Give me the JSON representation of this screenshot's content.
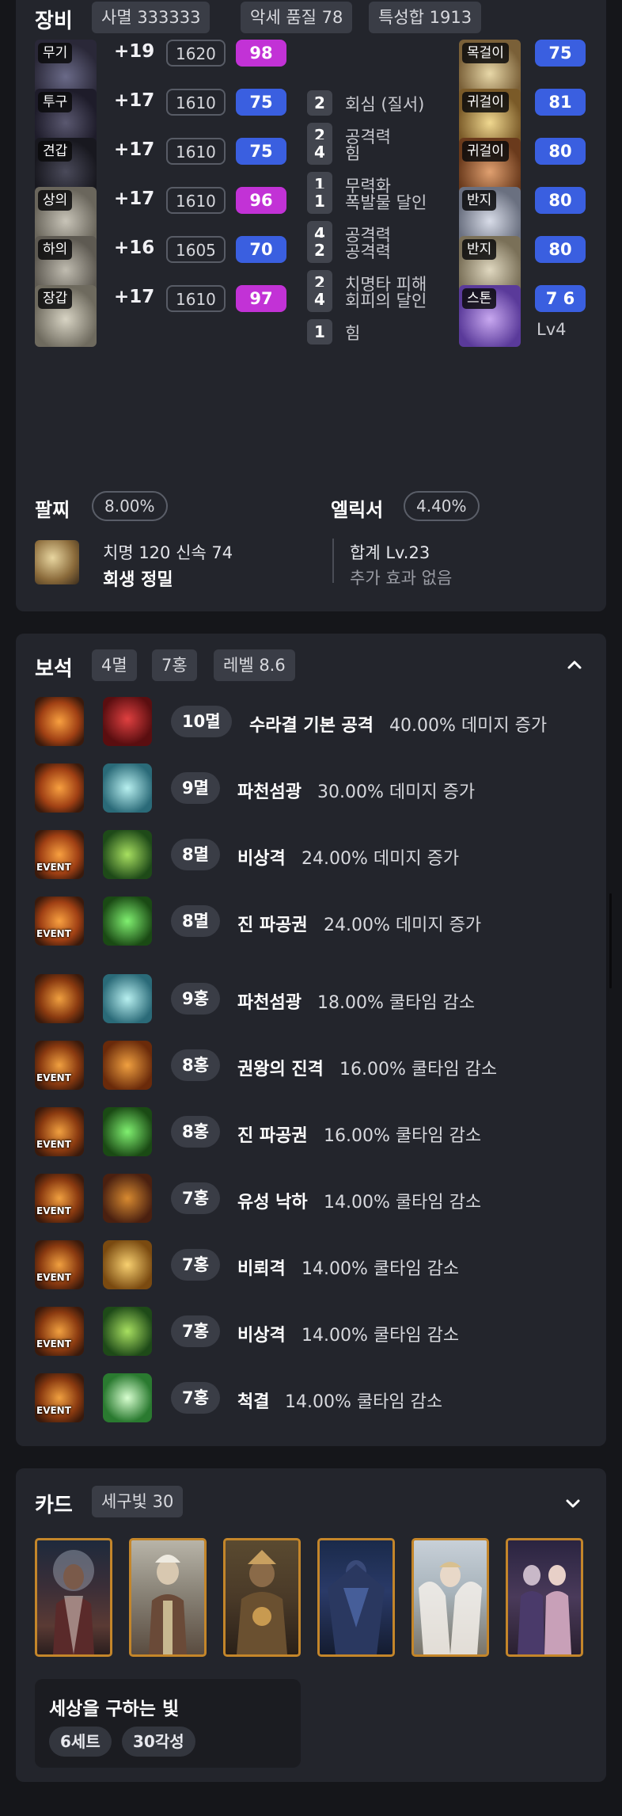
{
  "equipment": {
    "title": "장비",
    "chips": [
      "사멸 333333",
      "악세 품질 78",
      "특성합 1913"
    ],
    "gear": [
      {
        "label": "무기",
        "honing": "+19",
        "ilvl": "1620",
        "quality": "98",
        "quality_color": "#c232d6"
      },
      {
        "label": "투구",
        "honing": "+17",
        "ilvl": "1610",
        "quality": "75",
        "quality_color": "#3a5fe0",
        "eff": [
          {
            "n": "2",
            "t": "회심 (질서)"
          },
          {
            "n": "2",
            "t": "공격력"
          }
        ]
      },
      {
        "label": "견갑",
        "honing": "+17",
        "ilvl": "1610",
        "quality": "75",
        "quality_color": "#3a5fe0",
        "eff": [
          {
            "n": "4",
            "t": "힘"
          },
          {
            "n": "1",
            "t": "무력화"
          }
        ]
      },
      {
        "label": "상의",
        "honing": "+17",
        "ilvl": "1610",
        "quality": "96",
        "quality_color": "#c232d6",
        "eff": [
          {
            "n": "1",
            "t": "폭발물 달인"
          },
          {
            "n": "4",
            "t": "공격력"
          }
        ]
      },
      {
        "label": "하의",
        "honing": "+16",
        "ilvl": "1605",
        "quality": "70",
        "quality_color": "#3a5fe0",
        "eff": [
          {
            "n": "2",
            "t": "공격력"
          },
          {
            "n": "2",
            "t": "치명타 피해"
          }
        ]
      },
      {
        "label": "장갑",
        "honing": "+17",
        "ilvl": "1610",
        "quality": "97",
        "quality_color": "#c232d6",
        "eff": [
          {
            "n": "4",
            "t": "회피의 달인"
          },
          {
            "n": "1",
            "t": "힘"
          }
        ]
      }
    ],
    "accessories": [
      {
        "label": "목걸이",
        "quality": "75"
      },
      {
        "label": "귀걸이",
        "quality": "81"
      },
      {
        "label": "귀걸이",
        "quality": "80"
      },
      {
        "label": "반지",
        "quality": "80"
      },
      {
        "label": "반지",
        "quality": "80"
      },
      {
        "label": "스톤",
        "quality": "7 6",
        "sub": "Lv4"
      }
    ],
    "bracelet": {
      "title": "팔찌",
      "value": "8.00%",
      "line1": "치명 120  신속 74",
      "line2": "회생  정밀"
    },
    "elixir": {
      "title": "엘릭서",
      "value": "4.40%",
      "line1": "합계 Lv.23",
      "line2": "추가 효과 없음"
    }
  },
  "gems": {
    "title": "보석",
    "chips": [
      "4멸",
      "7홍",
      "레벨 8.6"
    ],
    "collapse_icon": "chevron-up-icon",
    "event_label": "EVENT",
    "items": [
      {
        "level": "10멸",
        "skill": "수라결 기본 공격",
        "effect": "40.00% 데미지 증가",
        "event": false,
        "icon": "red"
      },
      {
        "level": "9멸",
        "skill": "파천섬광",
        "effect": "30.00% 데미지 증가",
        "event": false,
        "icon": "cyan"
      },
      {
        "level": "8멸",
        "skill": "비상격",
        "effect": "24.00% 데미지 증가",
        "event": true,
        "icon": "green"
      },
      {
        "level": "8멸",
        "skill": "진 파공권",
        "effect": "24.00% 데미지 증가",
        "event": true,
        "icon": "green2"
      },
      {
        "level": "9홍",
        "skill": "파천섬광",
        "effect": "18.00% 쿨타임 감소",
        "event": false,
        "icon": "cyan"
      },
      {
        "level": "8홍",
        "skill": "권왕의 진격",
        "effect": "16.00% 쿨타임 감소",
        "event": true,
        "icon": "orange"
      },
      {
        "level": "8홍",
        "skill": "진 파공권",
        "effect": "16.00% 쿨타임 감소",
        "event": true,
        "icon": "green2"
      },
      {
        "level": "7홍",
        "skill": "유성 낙하",
        "effect": "14.00% 쿨타임 감소",
        "event": true,
        "icon": "orange2"
      },
      {
        "level": "7홍",
        "skill": "비뢰격",
        "effect": "14.00% 쿨타임 감소",
        "event": true,
        "icon": "gold"
      },
      {
        "level": "7홍",
        "skill": "비상격",
        "effect": "14.00% 쿨타임 감소",
        "event": true,
        "icon": "green"
      },
      {
        "level": "7홍",
        "skill": "척결",
        "effect": "14.00% 쿨타임 감소",
        "event": true,
        "icon": "green3"
      }
    ]
  },
  "cards": {
    "title": "카드",
    "chip": "세구빛 30",
    "expand_icon": "chevron-down-icon",
    "set_name": "세상을 구하는 빛",
    "set_tags": [
      "6세트",
      "30각성"
    ]
  }
}
